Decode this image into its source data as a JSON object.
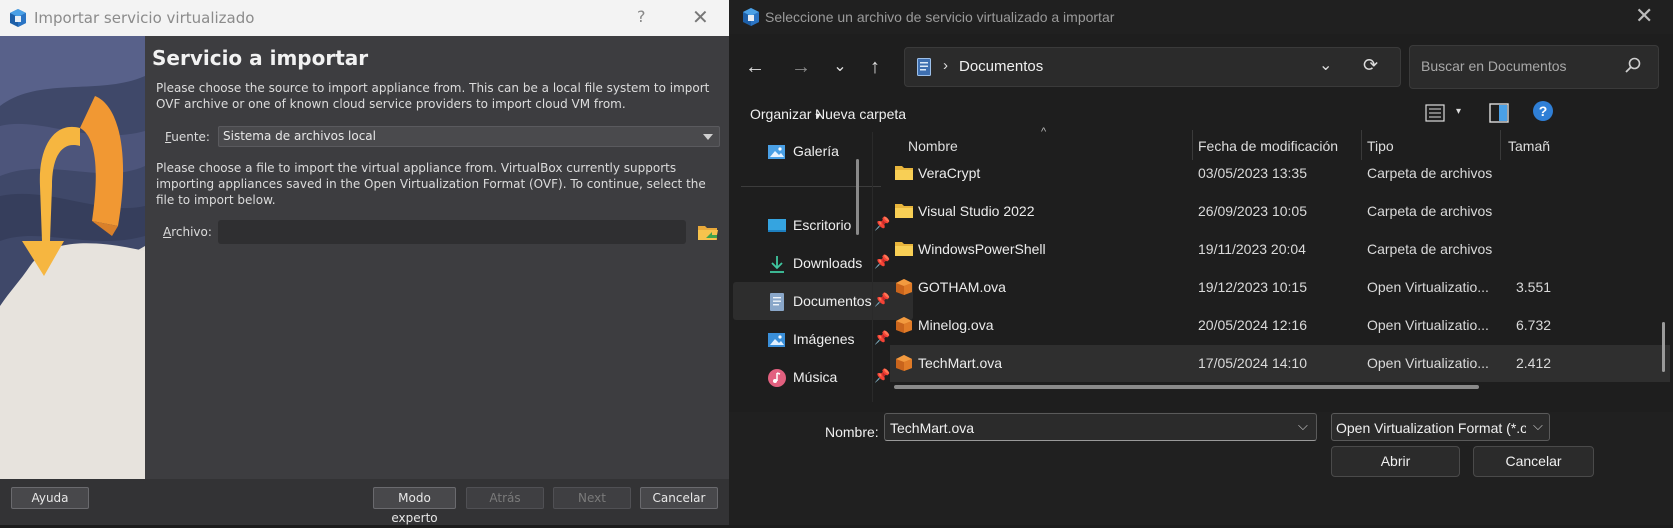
{
  "wizard": {
    "title": "Importar servicio virtualizado",
    "help_glyph": "?",
    "close_glyph": "✕",
    "heading": "Servicio a importar",
    "intro": "Please choose the source to import appliance from. This can be a local file system to import OVF archive or one of known cloud service providers to import cloud VM from.",
    "source_label_prefix": "",
    "source_label_underlined": "F",
    "source_label_rest": "uente:",
    "source_value": "Sistema de archivos local",
    "file_text": "Please choose a file to import the virtual appliance from. VirtualBox currently supports importing appliances saved in the Open Virtualization Format (OVF). To continue, select the file to import below.",
    "file_label_underlined": "A",
    "file_label_rest": "rchivo:",
    "file_value": "",
    "buttons": {
      "help": "Ayuda",
      "expert": "Modo experto",
      "back": "Atrás",
      "next": "Next",
      "cancel": "Cancelar"
    }
  },
  "dialog": {
    "title": "Seleccione un archivo de servicio virtualizado a importar",
    "close_glyph": "✕",
    "nav": {
      "back": "←",
      "forward": "→",
      "recent": "⌄",
      "up": "↑"
    },
    "breadcrumb": {
      "separator": "›",
      "location": "Documentos"
    },
    "search_placeholder": "Buscar en Documentos",
    "commands": {
      "organize": "Organizar",
      "organize_arrow": "▾",
      "new_folder": "Nueva carpeta",
      "view_arrow": "▾",
      "help": "?"
    },
    "sidebar": [
      {
        "label": "Galería",
        "icon": "gallery-icon",
        "pinned": false
      },
      {
        "label": "Escritorio",
        "icon": "desktop-icon",
        "pinned": true
      },
      {
        "label": "Downloads",
        "icon": "downloads-icon",
        "pinned": true
      },
      {
        "label": "Documentos",
        "icon": "documents-icon",
        "pinned": true
      },
      {
        "label": "Imágenes",
        "icon": "pictures-icon",
        "pinned": true
      },
      {
        "label": "Música",
        "icon": "music-icon",
        "pinned": true
      }
    ],
    "pin_glyph": "📌",
    "columns": {
      "name": "Nombre",
      "sort_glyph": "^",
      "modified": "Fecha de modificación",
      "type": "Tipo",
      "size": "Tamañ"
    },
    "files": [
      {
        "name": "VeraCrypt",
        "modified": "03/05/2023 13:35",
        "type": "Carpeta de archivos",
        "size": "",
        "kind": "folder"
      },
      {
        "name": "Visual Studio 2022",
        "modified": "26/09/2023 10:05",
        "type": "Carpeta de archivos",
        "size": "",
        "kind": "folder"
      },
      {
        "name": "WindowsPowerShell",
        "modified": "19/11/2023 20:04",
        "type": "Carpeta de archivos",
        "size": "",
        "kind": "folder"
      },
      {
        "name": "GOTHAM.ova",
        "modified": "19/12/2023 10:15",
        "type": "Open Virtualizatio...",
        "size": "3.551",
        "kind": "ova"
      },
      {
        "name": "Minelog.ova",
        "modified": "20/05/2024 12:16",
        "type": "Open Virtualizatio...",
        "size": "6.732",
        "kind": "ova"
      },
      {
        "name": "TechMart.ova",
        "modified": "17/05/2024 14:10",
        "type": "Open Virtualizatio...",
        "size": "2.412",
        "kind": "ova",
        "selected": true
      }
    ],
    "filename_label": "Nombre:",
    "filename_value": "TechMart.ova",
    "filetype_value": "Open Virtualization Format (*.ov",
    "dropdown_glyph": "⌵",
    "open_label": "Abrir",
    "cancel_label": "Cancelar"
  }
}
